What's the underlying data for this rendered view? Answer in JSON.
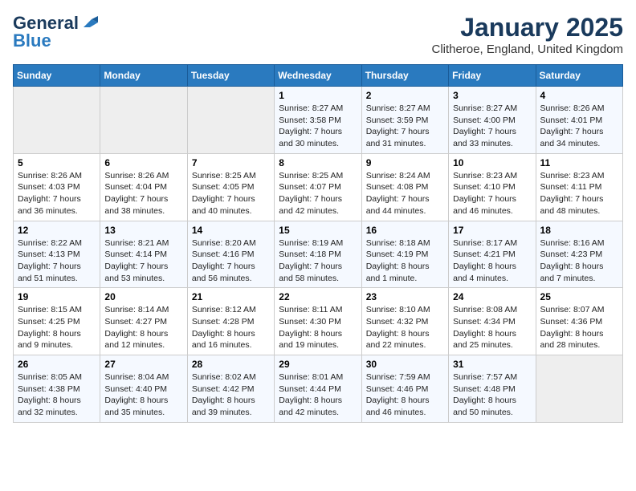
{
  "logo": {
    "general": "General",
    "blue": "Blue"
  },
  "title": "January 2025",
  "subtitle": "Clitheroe, England, United Kingdom",
  "headers": [
    "Sunday",
    "Monday",
    "Tuesday",
    "Wednesday",
    "Thursday",
    "Friday",
    "Saturday"
  ],
  "weeks": [
    [
      {
        "day": "",
        "info": ""
      },
      {
        "day": "",
        "info": ""
      },
      {
        "day": "",
        "info": ""
      },
      {
        "day": "1",
        "info": "Sunrise: 8:27 AM\nSunset: 3:58 PM\nDaylight: 7 hours and 30 minutes."
      },
      {
        "day": "2",
        "info": "Sunrise: 8:27 AM\nSunset: 3:59 PM\nDaylight: 7 hours and 31 minutes."
      },
      {
        "day": "3",
        "info": "Sunrise: 8:27 AM\nSunset: 4:00 PM\nDaylight: 7 hours and 33 minutes."
      },
      {
        "day": "4",
        "info": "Sunrise: 8:26 AM\nSunset: 4:01 PM\nDaylight: 7 hours and 34 minutes."
      }
    ],
    [
      {
        "day": "5",
        "info": "Sunrise: 8:26 AM\nSunset: 4:03 PM\nDaylight: 7 hours and 36 minutes."
      },
      {
        "day": "6",
        "info": "Sunrise: 8:26 AM\nSunset: 4:04 PM\nDaylight: 7 hours and 38 minutes."
      },
      {
        "day": "7",
        "info": "Sunrise: 8:25 AM\nSunset: 4:05 PM\nDaylight: 7 hours and 40 minutes."
      },
      {
        "day": "8",
        "info": "Sunrise: 8:25 AM\nSunset: 4:07 PM\nDaylight: 7 hours and 42 minutes."
      },
      {
        "day": "9",
        "info": "Sunrise: 8:24 AM\nSunset: 4:08 PM\nDaylight: 7 hours and 44 minutes."
      },
      {
        "day": "10",
        "info": "Sunrise: 8:23 AM\nSunset: 4:10 PM\nDaylight: 7 hours and 46 minutes."
      },
      {
        "day": "11",
        "info": "Sunrise: 8:23 AM\nSunset: 4:11 PM\nDaylight: 7 hours and 48 minutes."
      }
    ],
    [
      {
        "day": "12",
        "info": "Sunrise: 8:22 AM\nSunset: 4:13 PM\nDaylight: 7 hours and 51 minutes."
      },
      {
        "day": "13",
        "info": "Sunrise: 8:21 AM\nSunset: 4:14 PM\nDaylight: 7 hours and 53 minutes."
      },
      {
        "day": "14",
        "info": "Sunrise: 8:20 AM\nSunset: 4:16 PM\nDaylight: 7 hours and 56 minutes."
      },
      {
        "day": "15",
        "info": "Sunrise: 8:19 AM\nSunset: 4:18 PM\nDaylight: 7 hours and 58 minutes."
      },
      {
        "day": "16",
        "info": "Sunrise: 8:18 AM\nSunset: 4:19 PM\nDaylight: 8 hours and 1 minute."
      },
      {
        "day": "17",
        "info": "Sunrise: 8:17 AM\nSunset: 4:21 PM\nDaylight: 8 hours and 4 minutes."
      },
      {
        "day": "18",
        "info": "Sunrise: 8:16 AM\nSunset: 4:23 PM\nDaylight: 8 hours and 7 minutes."
      }
    ],
    [
      {
        "day": "19",
        "info": "Sunrise: 8:15 AM\nSunset: 4:25 PM\nDaylight: 8 hours and 9 minutes."
      },
      {
        "day": "20",
        "info": "Sunrise: 8:14 AM\nSunset: 4:27 PM\nDaylight: 8 hours and 12 minutes."
      },
      {
        "day": "21",
        "info": "Sunrise: 8:12 AM\nSunset: 4:28 PM\nDaylight: 8 hours and 16 minutes."
      },
      {
        "day": "22",
        "info": "Sunrise: 8:11 AM\nSunset: 4:30 PM\nDaylight: 8 hours and 19 minutes."
      },
      {
        "day": "23",
        "info": "Sunrise: 8:10 AM\nSunset: 4:32 PM\nDaylight: 8 hours and 22 minutes."
      },
      {
        "day": "24",
        "info": "Sunrise: 8:08 AM\nSunset: 4:34 PM\nDaylight: 8 hours and 25 minutes."
      },
      {
        "day": "25",
        "info": "Sunrise: 8:07 AM\nSunset: 4:36 PM\nDaylight: 8 hours and 28 minutes."
      }
    ],
    [
      {
        "day": "26",
        "info": "Sunrise: 8:05 AM\nSunset: 4:38 PM\nDaylight: 8 hours and 32 minutes."
      },
      {
        "day": "27",
        "info": "Sunrise: 8:04 AM\nSunset: 4:40 PM\nDaylight: 8 hours and 35 minutes."
      },
      {
        "day": "28",
        "info": "Sunrise: 8:02 AM\nSunset: 4:42 PM\nDaylight: 8 hours and 39 minutes."
      },
      {
        "day": "29",
        "info": "Sunrise: 8:01 AM\nSunset: 4:44 PM\nDaylight: 8 hours and 42 minutes."
      },
      {
        "day": "30",
        "info": "Sunrise: 7:59 AM\nSunset: 4:46 PM\nDaylight: 8 hours and 46 minutes."
      },
      {
        "day": "31",
        "info": "Sunrise: 7:57 AM\nSunset: 4:48 PM\nDaylight: 8 hours and 50 minutes."
      },
      {
        "day": "",
        "info": ""
      }
    ]
  ]
}
